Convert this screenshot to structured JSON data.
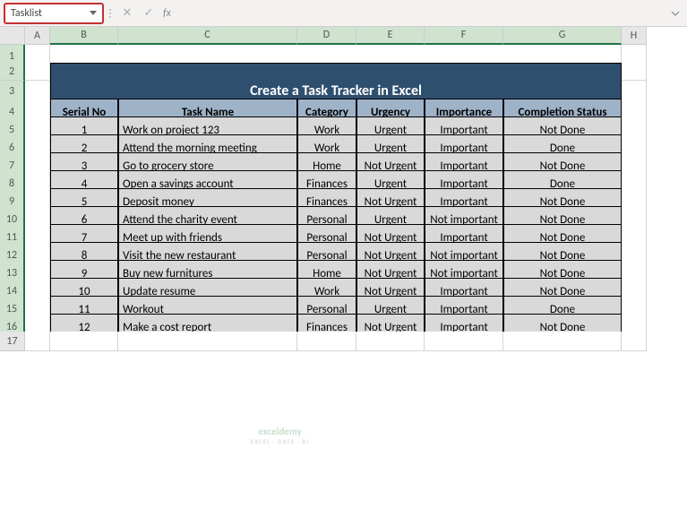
{
  "name_box": {
    "value": "Tasklist"
  },
  "formula_bar": {
    "fx": "fx",
    "value": ""
  },
  "columns": [
    "",
    "A",
    "B",
    "C",
    "D",
    "E",
    "F",
    "G",
    "H"
  ],
  "rows": [
    "1",
    "2",
    "3",
    "4",
    "5",
    "6",
    "7",
    "8",
    "9",
    "10",
    "11",
    "12",
    "13",
    "14",
    "15",
    "16",
    "17"
  ],
  "title": "Create a Task Tracker in Excel",
  "headers": [
    "Serial No",
    "Task Name",
    "Category",
    "Urgency",
    "Importance",
    "Completion Status"
  ],
  "tasks": [
    {
      "serial": "1",
      "name": "Work on project 123",
      "category": "Work",
      "urgency": "Urgent",
      "importance": "Important",
      "status": "Not Done"
    },
    {
      "serial": "2",
      "name": "Attend the morning meeting",
      "category": "Work",
      "urgency": "Urgent",
      "importance": "Important",
      "status": "Done"
    },
    {
      "serial": "3",
      "name": "Go to grocery store",
      "category": "Home",
      "urgency": "Not Urgent",
      "importance": "Important",
      "status": "Not Done"
    },
    {
      "serial": "4",
      "name": "Open a savings account",
      "category": "Finances",
      "urgency": "Urgent",
      "importance": "Important",
      "status": "Done"
    },
    {
      "serial": "5",
      "name": "Deposit money",
      "category": "Finances",
      "urgency": "Not Urgent",
      "importance": "Important",
      "status": "Not Done"
    },
    {
      "serial": "6",
      "name": "Attend the charity event",
      "category": "Personal",
      "urgency": "Urgent",
      "importance": "Not important",
      "status": "Not Done"
    },
    {
      "serial": "7",
      "name": "Meet up with friends",
      "category": "Personal",
      "urgency": "Not Urgent",
      "importance": "Important",
      "status": "Not Done"
    },
    {
      "serial": "8",
      "name": "Visit the new restaurant",
      "category": "Personal",
      "urgency": "Not Urgent",
      "importance": "Not important",
      "status": "Not Done"
    },
    {
      "serial": "9",
      "name": "Buy new furnitures",
      "category": "Home",
      "urgency": "Not Urgent",
      "importance": "Not important",
      "status": "Not Done"
    },
    {
      "serial": "10",
      "name": "Update resume",
      "category": "Work",
      "urgency": "Not Urgent",
      "importance": "Important",
      "status": "Not Done"
    },
    {
      "serial": "11",
      "name": "Workout",
      "category": "Personal",
      "urgency": "Urgent",
      "importance": "Important",
      "status": "Done"
    },
    {
      "serial": "12",
      "name": "Make a cost report",
      "category": "Finances",
      "urgency": "Not Urgent",
      "importance": "Important",
      "status": "Not Done"
    }
  ],
  "watermark": {
    "brand": "exceldemy",
    "sub": "EXCEL · DATA · BI"
  }
}
